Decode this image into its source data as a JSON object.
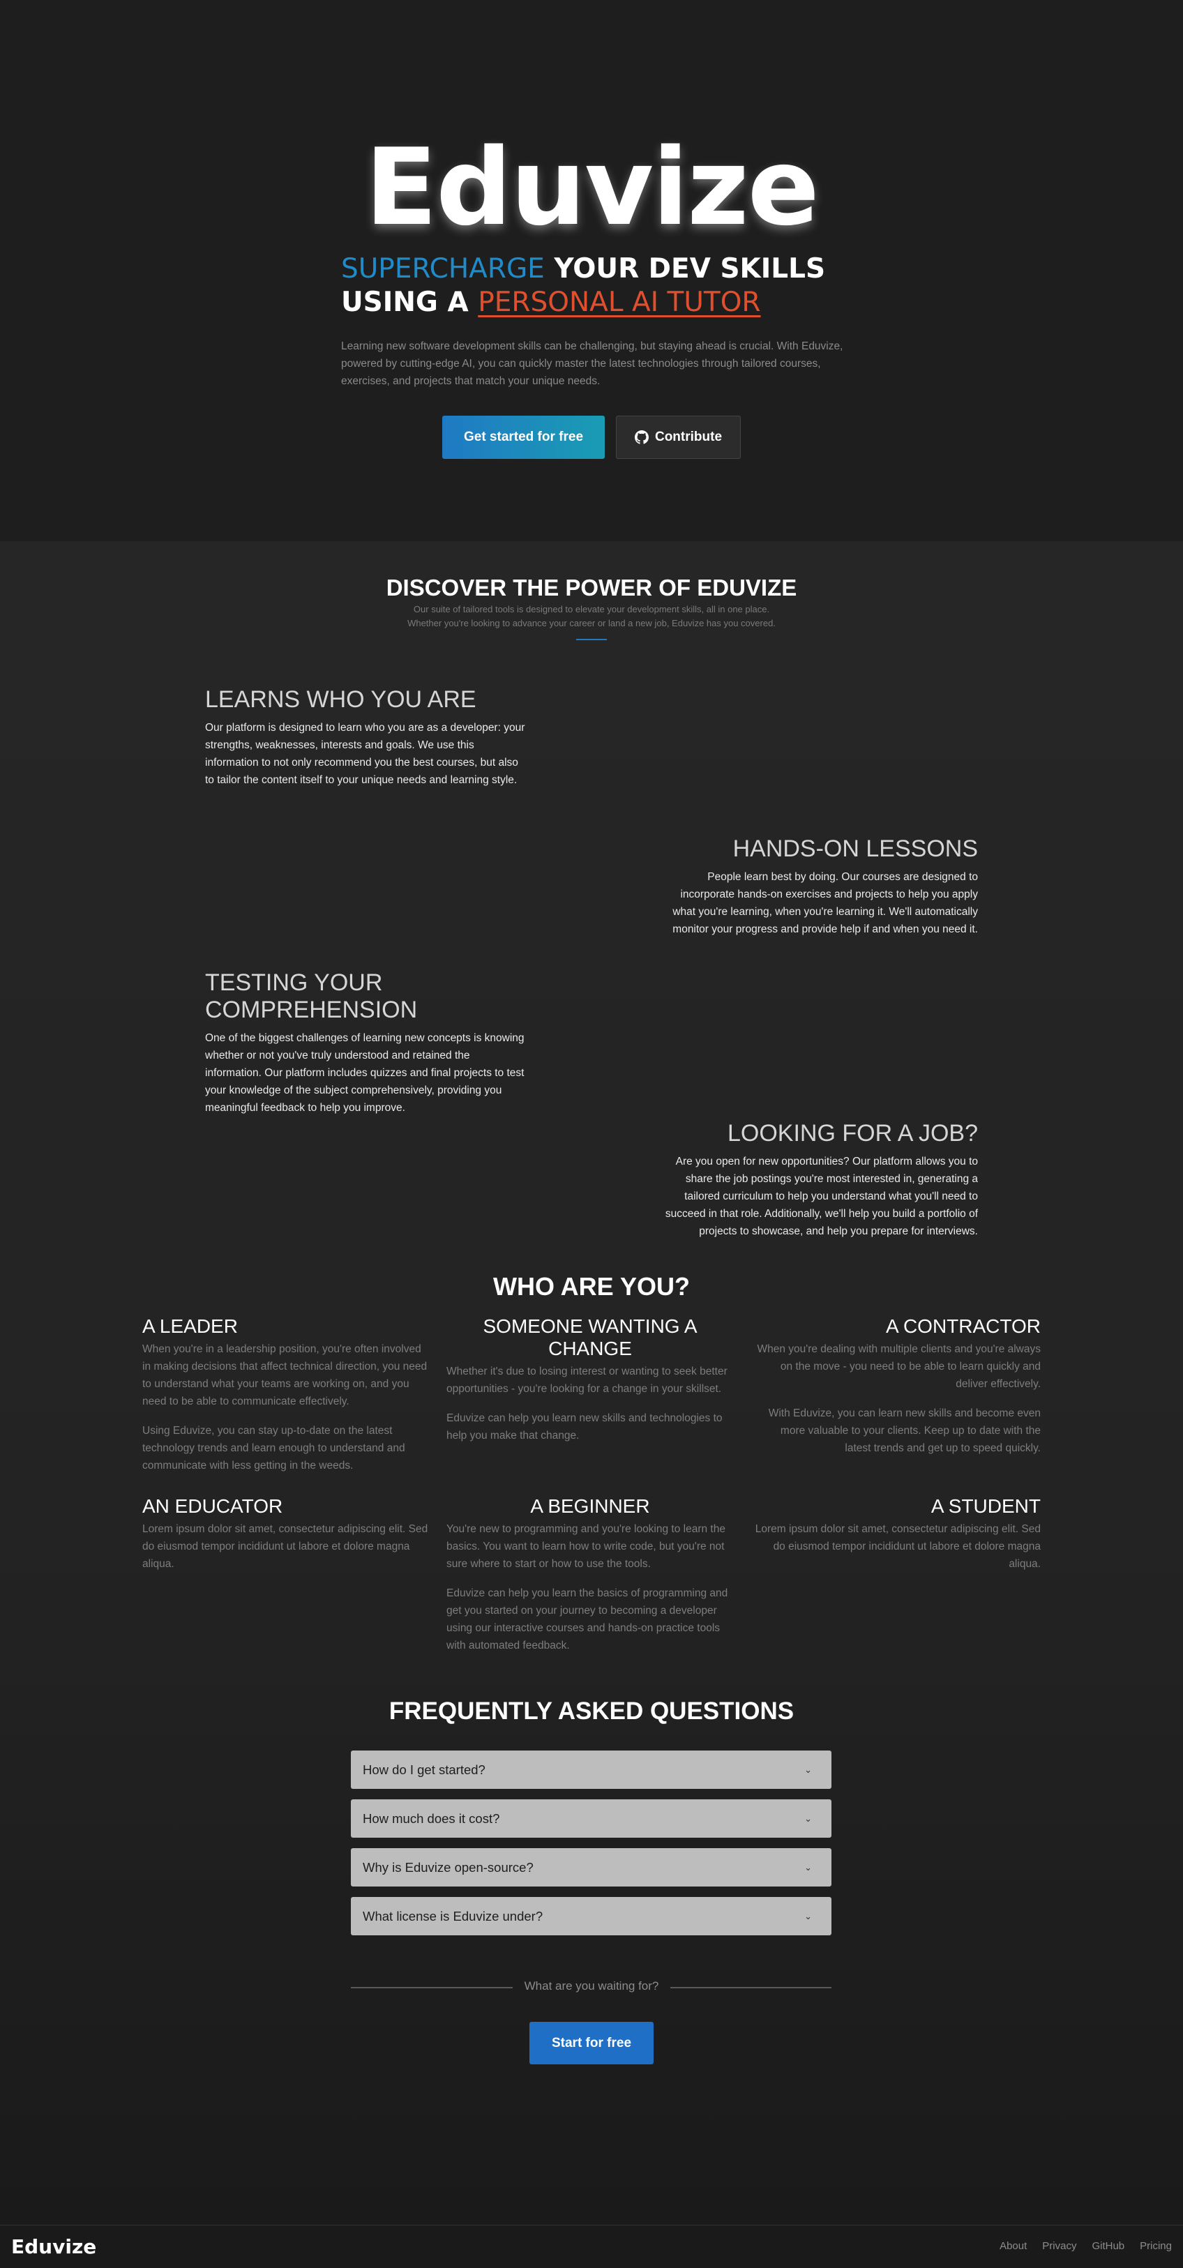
{
  "hero": {
    "logo": "Eduvize",
    "tagline": {
      "part1": "SUPERCHARGE",
      "part2": " YOUR DEV SKILLS",
      "part3": "USING A ",
      "part4": "PERSONAL AI TUTOR"
    },
    "description": "Learning new software development skills can be challenging, but staying ahead is crucial. With Eduvize, powered by cutting-edge AI, you can quickly master the latest technologies through tailored courses, exercises, and projects that match your unique needs.",
    "primary_button": "Get started for free",
    "contribute_button": "Contribute",
    "contribute_icon": "github-icon"
  },
  "discover": {
    "title": "DISCOVER THE POWER OF EDUVIZE",
    "subtitle_line1": "Our suite of tailored tools is designed to elevate your development skills, all in one place.",
    "subtitle_line2": "Whether you're looking to advance your career or land a new job, Eduvize has you covered.",
    "features": [
      {
        "title": "LEARNS WHO YOU ARE",
        "text": "Our platform is designed to learn who you are as a developer: your strengths, weaknesses, interests and goals. We use this information to not only recommend you the best courses, but also to tailor the content itself to your unique needs and learning style."
      },
      {
        "title": "HANDS-ON LESSONS",
        "text": "People learn best by doing. Our courses are designed to incorporate hands-on exercises and projects to help you apply what you're learning, when you're learning it. We'll automatically monitor your progress and provide help if and when you need it."
      },
      {
        "title": "TESTING YOUR COMPREHENSION",
        "text": "One of the biggest challenges of learning new concepts is knowing whether or not you've truly understood and retained the information. Our platform includes quizzes and final projects to test your knowledge of the subject comprehensively, providing you meaningful feedback to help you improve."
      },
      {
        "title": "LOOKING FOR A JOB?",
        "text": "Are you open for new opportunities? Our platform allows you to share the job postings you're most interested in, generating a tailored curriculum to help you understand what you'll need to succeed in that role. Additionally, we'll help you build a portfolio of projects to showcase, and help you prepare for interviews."
      }
    ]
  },
  "who": {
    "title": "WHO ARE YOU?",
    "roles": [
      {
        "title": "A LEADER",
        "p1": "When you're in a leadership position, you're often involved in making decisions that affect technical direction, you need to understand what your teams are working on, and you need to be able to communicate effectively.",
        "p2": "Using Eduvize, you can stay up-to-date on the latest technology trends and learn enough to understand and communicate with less getting in the weeds."
      },
      {
        "title": "SOMEONE WANTING A CHANGE",
        "p1": "Whether it's due to losing interest or wanting to seek better opportunities - you're looking for a change in your skillset.",
        "p2": "Eduvize can help you learn new skills and technologies to help you make that change."
      },
      {
        "title": "A CONTRACTOR",
        "p1": "When you're dealing with multiple clients and you're always on the move - you need to be able to learn quickly and deliver effectively.",
        "p2": "With Eduvize, you can learn new skills and become even more valuable to your clients. Keep up to date with the latest trends and get up to speed quickly."
      },
      {
        "title": "AN EDUCATOR",
        "p1": "Lorem ipsum dolor sit amet, consectetur adipiscing elit. Sed do eiusmod tempor incididunt ut labore et dolore magna aliqua."
      },
      {
        "title": "A BEGINNER",
        "p1": "You're new to programming and you're looking to learn the basics. You want to learn how to write code, but you're not sure where to start or how to use the tools.",
        "p2": "Eduvize can help you learn the basics of programming and get you started on your journey to becoming a developer using our interactive courses and hands-on practice tools with automated feedback."
      },
      {
        "title": "A STUDENT",
        "p1": "Lorem ipsum dolor sit amet, consectetur adipiscing elit. Sed do eiusmod tempor incididunt ut labore et dolore magna aliqua."
      }
    ]
  },
  "faq": {
    "title": "FREQUENTLY ASKED QUESTIONS",
    "items": [
      "How do I get started?",
      "How much does it cost?",
      "Why is Eduvize open-source?",
      "What license is Eduvize under?"
    ],
    "chevron": "chevron-down-icon"
  },
  "cta": {
    "prompt": "What are you waiting for?",
    "button": "Start for free"
  },
  "footer": {
    "logo": "Eduvize",
    "links": [
      "About",
      "Privacy",
      "GitHub",
      "Pricing"
    ]
  },
  "colors": {
    "accent_blue": "#1f7ac4",
    "accent_teal": "#1a9cb3",
    "accent_orange": "#e0502e",
    "background": "#1e1e1e"
  }
}
